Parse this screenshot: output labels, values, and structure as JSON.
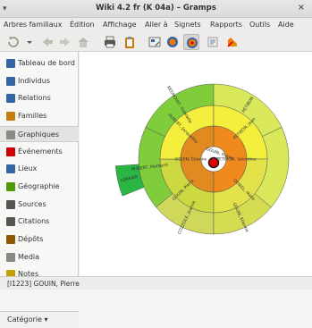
{
  "window": {
    "title": "Wiki 4.2 fr (K 04a) – Gramps",
    "close": "×"
  },
  "menubar": {
    "items": [
      {
        "label": "Arbres familiaux",
        "u": "A"
      },
      {
        "label": "Édition",
        "u": "É"
      },
      {
        "label": "Affichage",
        "u": "A"
      },
      {
        "label": "Aller à",
        "u": "l"
      },
      {
        "label": "Signets",
        "u": "S"
      },
      {
        "label": "Rapports",
        "u": "R"
      },
      {
        "label": "Outils",
        "u": "O"
      },
      {
        "label": "Aide",
        "u": "d"
      }
    ]
  },
  "toolbar": {
    "buttons": [
      "reload-icon",
      "dropdown-icon",
      "back-icon",
      "forward-icon",
      "home-icon",
      "print-icon",
      "clipboard-icon",
      "config-icon",
      "pedigree-icon",
      "fan-icon",
      "fan-active-icon",
      "descendant-icon",
      "report-icon"
    ]
  },
  "sidebar": {
    "items": [
      {
        "label": "Tableau de bord",
        "icon": "dashboard-icon",
        "color": "#3465a4"
      },
      {
        "label": "Individus",
        "icon": "people-icon",
        "color": "#3465a4"
      },
      {
        "label": "Relations",
        "icon": "relations-icon",
        "color": "#3465a4"
      },
      {
        "label": "Familles",
        "icon": "families-icon",
        "color": "#c17d11"
      },
      {
        "label": "Graphiques",
        "icon": "charts-icon",
        "color": "#888a85",
        "selected": true
      },
      {
        "label": "Événements",
        "icon": "events-icon",
        "color": "#cc0000"
      },
      {
        "label": "Lieux",
        "icon": "places-icon",
        "color": "#3465a4"
      },
      {
        "label": "Géographie",
        "icon": "geography-icon",
        "color": "#4e9a06"
      },
      {
        "label": "Sources",
        "icon": "sources-icon",
        "color": "#555753"
      },
      {
        "label": "Citations",
        "icon": "citations-icon",
        "color": "#555753"
      },
      {
        "label": "Dépôts",
        "icon": "repositories-icon",
        "color": "#8f5902"
      },
      {
        "label": "Media",
        "icon": "media-icon",
        "color": "#888a85"
      },
      {
        "label": "Notes",
        "icon": "notes-icon",
        "color": "#c4a000"
      }
    ],
    "category": "Catégorie ▾"
  },
  "fanchart": {
    "center": "GOUIN, Pierre",
    "gen1": [
      "GOUIN, Étienne",
      "PETIBON, Valentine"
    ],
    "gen2": [
      "HUBERT, Jacqueline",
      "GOUIN, Pierre",
      "PETIBON, Jean",
      "DENIEL, Marie"
    ],
    "gen3": [
      "REGNOULT, Gabrielle",
      "HUBERT, Mathurin",
      "COZZOLE, Jeanne",
      "GOUIN, Etienne",
      "PETIBON",
      ""
    ],
    "gen4": [
      "LORRIER"
    ]
  },
  "status": {
    "text": "[I1223] GOUIN, Pierre"
  }
}
